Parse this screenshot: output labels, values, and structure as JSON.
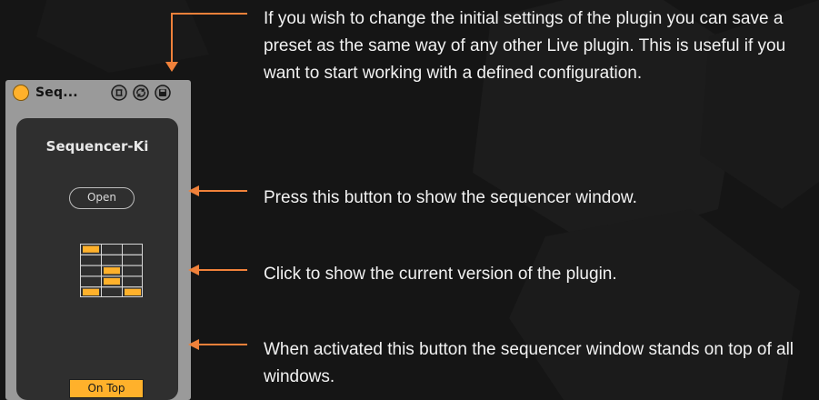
{
  "device": {
    "title": "Seq...",
    "name": "Sequencer-Ki",
    "open_label": "Open",
    "ontop_label": "On Top",
    "ontop_active": true,
    "header_icons": [
      "routing-icon",
      "hot-swap-icon",
      "save-preset-icon"
    ],
    "version_grid": [
      [
        1,
        0,
        0
      ],
      [
        0,
        0,
        0
      ],
      [
        0,
        1,
        0
      ],
      [
        0,
        1,
        0
      ],
      [
        1,
        0,
        1
      ]
    ]
  },
  "annotations": {
    "preset": "If you wish to change the initial settings of the plugin you can save a preset as the same way of any other Live plugin. This is useful if you want to start working with a defined configuration.",
    "open": "Press this button to show the sequencer window.",
    "version": "Click to show the current version of the plugin.",
    "ontop": "When activated this button the sequencer window stands on top of all windows."
  },
  "colors": {
    "accent": "#ffb12b",
    "arrow": "#f0813a",
    "background": "#151515",
    "panel": "#9a9a9a",
    "panel_body": "#2f2f2f",
    "text": "#f2f2f2"
  }
}
